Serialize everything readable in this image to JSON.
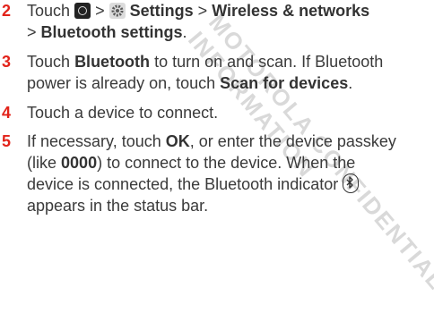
{
  "watermark": [
    "ENTIAL",
    "MOTOROLA CONFIDENTIAL",
    "INFORMATION"
  ],
  "steps": [
    {
      "num": "2",
      "line1": {
        "t1": "Touch",
        "sep1": ">",
        "settings": "Settings",
        "sep2": ">",
        "wireless": "Wireless & networks"
      },
      "line2": {
        "sep": ">",
        "bt_settings": "Bluetooth settings",
        "end": "."
      }
    },
    {
      "num": "3",
      "line1": {
        "t1": "Touch",
        "bt": "Bluetooth",
        "t2": "to turn on and scan. If Bluetooth"
      },
      "line2": {
        "t1": "power is already on, touch",
        "scan": "Scan for devices",
        "end": "."
      }
    },
    {
      "num": "4",
      "line1": {
        "text": "Touch a device to connect."
      }
    },
    {
      "num": "5",
      "line1": {
        "t1": "If necessary, touch",
        "ok": "OK",
        "t2": ", or enter the device passkey"
      },
      "line2": {
        "t1": "(like",
        "code": "0000",
        "t2": ") to connect to the device. When the"
      },
      "line3": {
        "text": "device is connected, the Bluetooth indicator"
      },
      "line4": {
        "text": "appears in the status bar."
      }
    }
  ],
  "icons": {
    "menu": "menu-key-icon",
    "settings": "settings-gear-icon",
    "bluetooth": "bluetooth-icon"
  }
}
